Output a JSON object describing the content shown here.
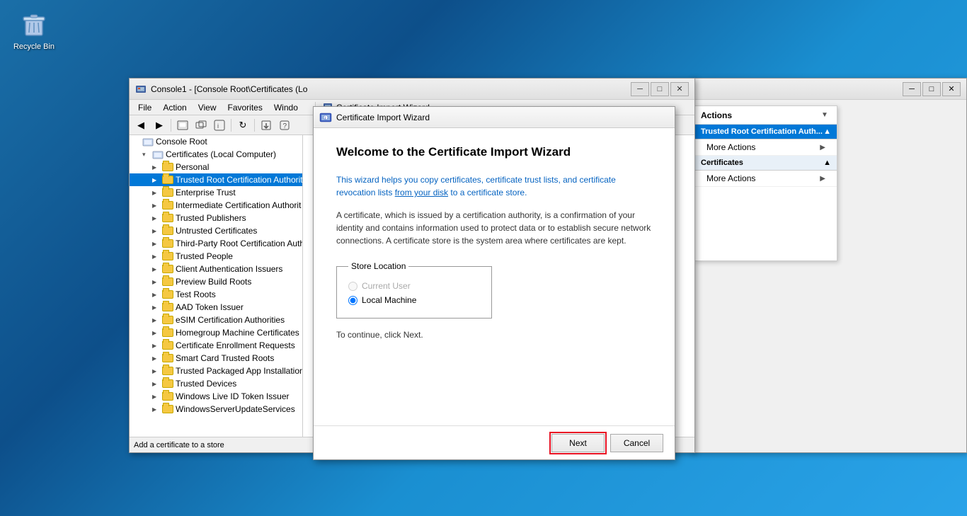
{
  "desktop": {
    "recycle_bin": {
      "label": "Recycle Bin"
    }
  },
  "mmc_window": {
    "title": "Console1 - [Console Root\\Certificates (Lo",
    "menubar": [
      "File",
      "Action",
      "View",
      "Favorites",
      "Windo"
    ],
    "tree": {
      "root": "Console Root",
      "certificates_node": "Certificates (Local Computer)",
      "items": [
        "Personal",
        "Trusted Root Certification Authorit",
        "Enterprise Trust",
        "Intermediate Certification Authorit",
        "Trusted Publishers",
        "Untrusted Certificates",
        "Third-Party Root Certification Auth",
        "Trusted People",
        "Client Authentication Issuers",
        "Preview Build Roots",
        "Test Roots",
        "AAD Token Issuer",
        "eSIM Certification Authorities",
        "Homegroup Machine Certificates",
        "Certificate Enrollment Requests",
        "Smart Card Trusted Roots",
        "Trusted Packaged App Installation",
        "Trusted Devices",
        "Windows Live ID Token Issuer",
        "WindowsServerUpdateServices"
      ]
    },
    "statusbar": "Add a certificate to a store"
  },
  "wizard": {
    "title": "Certificate Import Wizard",
    "heading": "Welcome to the Certificate Import Wizard",
    "desc1": "This wizard helps you copy certificates, certificate trust lists, and certificate revocation lists from your disk to a certificate store.",
    "desc2": "A certificate, which is issued by a certification authority, is a confirmation of your identity and contains information used to protect data or to establish secure network connections. A certificate store is the system area where certificates are kept.",
    "store_location": {
      "label": "Store Location",
      "option1": "Current User",
      "option2": "Local Machine"
    },
    "continue_text": "To continue, click Next.",
    "btn_next": "Next",
    "btn_cancel": "Cancel"
  },
  "actions_panel": {
    "title": "Actions",
    "section1": {
      "label": "Trusted Root Certification Auth...",
      "more_actions": "More Actions"
    },
    "section2": {
      "label": "Certificates",
      "more_actions": "More Actions"
    }
  },
  "behind_window": {
    "title": ""
  },
  "icons": {
    "back": "◀",
    "forward": "▶",
    "up": "⬆",
    "refresh": "↻",
    "minimize": "─",
    "maximize": "□",
    "close": "✕",
    "arrow_right": "▶",
    "expand": "▲",
    "collapse": "▼",
    "chevron_right": "›",
    "chevron_down": "▾"
  },
  "colors": {
    "selected_blue": "#0078d7",
    "folder_yellow": "#f5c842",
    "link_blue": "#0563c1",
    "next_outline": "#e81123"
  }
}
